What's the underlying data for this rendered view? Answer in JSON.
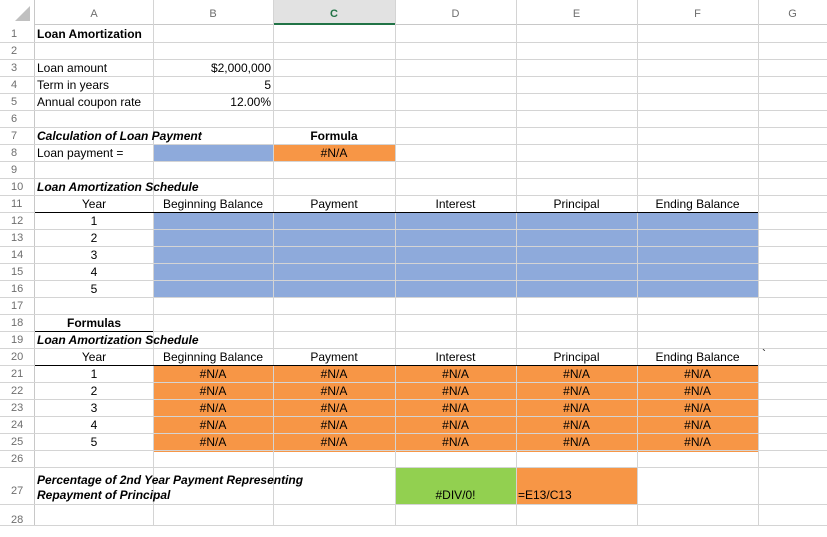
{
  "columns": [
    "A",
    "B",
    "C",
    "D",
    "E",
    "F",
    "G"
  ],
  "rows": [
    "1",
    "2",
    "3",
    "4",
    "5",
    "6",
    "7",
    "8",
    "9",
    "10",
    "11",
    "12",
    "13",
    "14",
    "15",
    "16",
    "17",
    "18",
    "19",
    "20",
    "21",
    "22",
    "23",
    "24",
    "25",
    "26",
    "27",
    "28"
  ],
  "colors": {
    "blue_fill": "#8eaadb",
    "orange_fill": "#f79646",
    "green_fill": "#92d050",
    "selected_header": "#217346"
  },
  "title": "Loan Amortization",
  "inputs": {
    "loan_amount_label": "Loan amount",
    "loan_amount_value": "$2,000,000",
    "term_label": "Term in years",
    "term_value": "5",
    "rate_label": "Annual coupon rate",
    "rate_value": "12.00%"
  },
  "payment": {
    "heading": "Calculation of Loan Payment",
    "formula_heading": "Formula",
    "label": "Loan payment =",
    "formula_value": "#N/A"
  },
  "schedule": {
    "heading": "Loan Amortization Schedule",
    "headers": [
      "Year",
      "Beginning Balance",
      "Payment",
      "Interest",
      "Principal",
      "Ending Balance"
    ],
    "years": [
      "1",
      "2",
      "3",
      "4",
      "5"
    ]
  },
  "formulas": {
    "label": "Formulas",
    "heading": "Loan Amortization Schedule",
    "headers": [
      "Year",
      "Beginning Balance",
      "Payment",
      "Interest",
      "Principal",
      "Ending Balance"
    ],
    "stray_mark": "`",
    "years": [
      "1",
      "2",
      "3",
      "4",
      "5"
    ],
    "cells": [
      [
        "#N/A",
        "#N/A",
        "#N/A",
        "#N/A",
        "#N/A"
      ],
      [
        "#N/A",
        "#N/A",
        "#N/A",
        "#N/A",
        "#N/A"
      ],
      [
        "#N/A",
        "#N/A",
        "#N/A",
        "#N/A",
        "#N/A"
      ],
      [
        "#N/A",
        "#N/A",
        "#N/A",
        "#N/A",
        "#N/A"
      ],
      [
        "#N/A",
        "#N/A",
        "#N/A",
        "#N/A",
        "#N/A"
      ]
    ]
  },
  "percentage": {
    "label_line1": "Percentage of 2nd Year Payment Representing",
    "label_line2": "Repayment of Principal",
    "value": "#DIV/0!",
    "formula": "=E13/C13"
  }
}
